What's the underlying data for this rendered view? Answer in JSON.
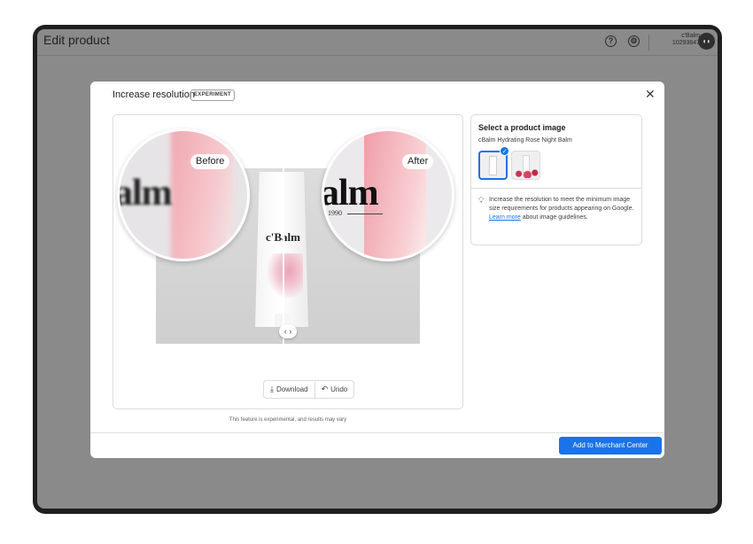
{
  "app": {
    "title": "Edit product",
    "help_icon": "help-circle-icon",
    "settings_icon": "gear-icon",
    "account_name": "c'Balm",
    "account_id": "10293847",
    "avatar_icon": "merchant-avatar-icon"
  },
  "dialog": {
    "title": "Increase resolution",
    "badge": "EXPERIMENT",
    "close_icon": "close-icon",
    "preview": {
      "before_label": "Before",
      "after_label": "After",
      "product_brand": "c'Balm",
      "after_year": "1990",
      "word_fragment": "alm",
      "slider_icon": "chevron-left-right-icon",
      "download_label": "Download",
      "download_icon": "download-icon",
      "undo_label": "Undo",
      "undo_icon": "undo-icon"
    },
    "disclaimer": "This feature is experimental, and results may vary",
    "side_panel": {
      "title": "Select a product image",
      "product_name": "cBalm Hydrating Rose Night Balm",
      "selected_index": 0,
      "tip_icon": "lightbulb-icon",
      "tip_before_link": "Increase the resolution to meet the minimum image size requirements for products appearing on Google.",
      "tip_link": "Learn more",
      "tip_after_link": "about image guidelines."
    },
    "primary_button": "Add to Merchant Center"
  },
  "colors": {
    "accent": "#1a73e8",
    "overlay": "#8a8a8a",
    "frame": "#1f1f1f"
  }
}
